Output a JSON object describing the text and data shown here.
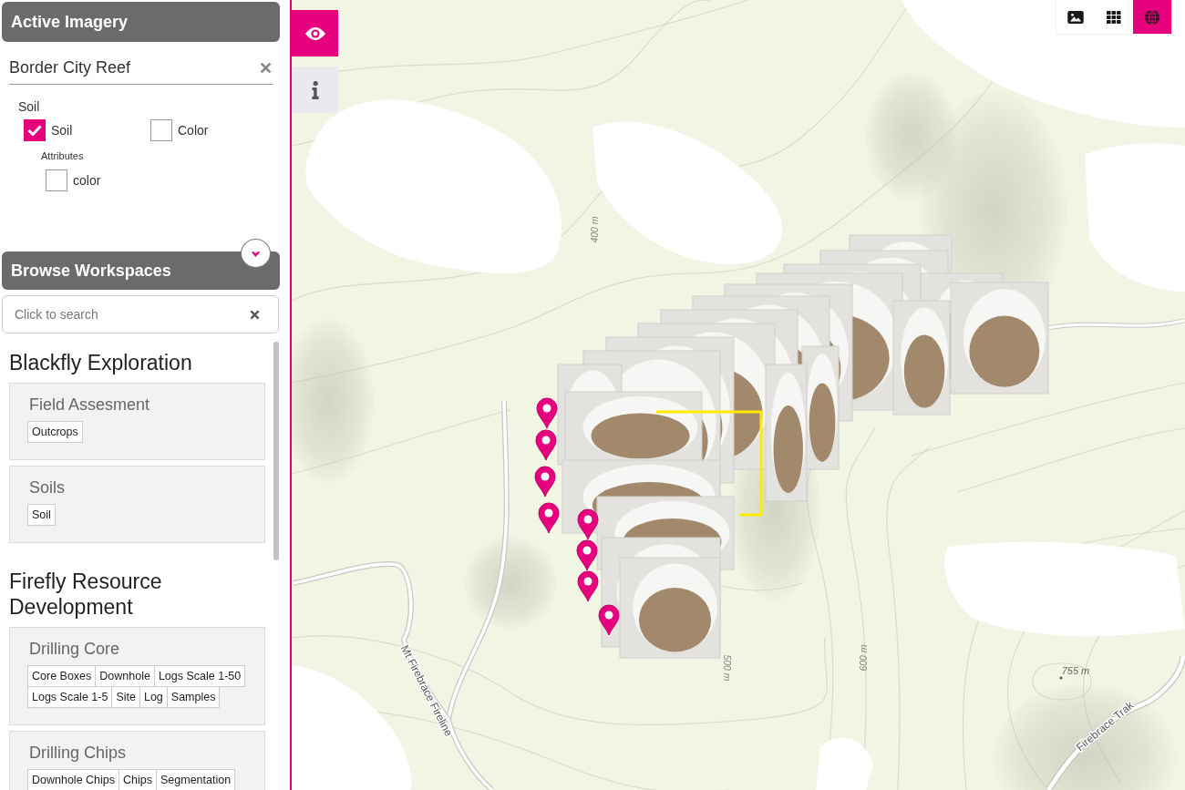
{
  "active_imagery": {
    "title": "Active Imagery",
    "site": "Border City Reef",
    "group_label": "Soil",
    "layers": [
      {
        "label": "Soil",
        "checked": true
      },
      {
        "label": "Color",
        "checked": false
      }
    ],
    "attributes_label": "Attributes",
    "attributes": [
      {
        "label": "color",
        "checked": false
      }
    ]
  },
  "browse": {
    "title": "Browse Workspaces",
    "search": {
      "placeholder": "Click to search"
    },
    "organizations": [
      {
        "name": "Blackfly Exploration",
        "workspaces": [
          {
            "name": "Field Assesment",
            "tags": [
              "Outcrops"
            ]
          },
          {
            "name": "Soils",
            "tags": [
              "Soil"
            ]
          }
        ]
      },
      {
        "name": "Firefly Resource Development",
        "workspaces": [
          {
            "name": "Drilling Core",
            "tags": [
              "Core Boxes",
              "Downhole",
              "Logs Scale 1-50",
              "Logs Scale 1-5",
              "Site",
              "Log",
              "Samples"
            ]
          },
          {
            "name": "Drilling Chips",
            "tags": [
              "Downhole Chips",
              "Chips",
              "Segmentation"
            ]
          }
        ]
      }
    ]
  },
  "map": {
    "tools": [
      {
        "selected": true
      },
      {
        "selected": false
      }
    ],
    "basemaps": [
      {
        "selected": false
      },
      {
        "selected": false
      },
      {
        "selected": true
      }
    ],
    "labels": [
      {
        "text": "400 m",
        "kind": "contour"
      },
      {
        "text": "Mt Firebrace Fireline",
        "kind": "road"
      },
      {
        "text": "500 m",
        "kind": "contour"
      },
      {
        "text": "600 m",
        "kind": "contour"
      },
      {
        "text": "755 m",
        "kind": "spot"
      },
      {
        "text": "Firebrace Trak",
        "kind": "road"
      }
    ]
  }
}
